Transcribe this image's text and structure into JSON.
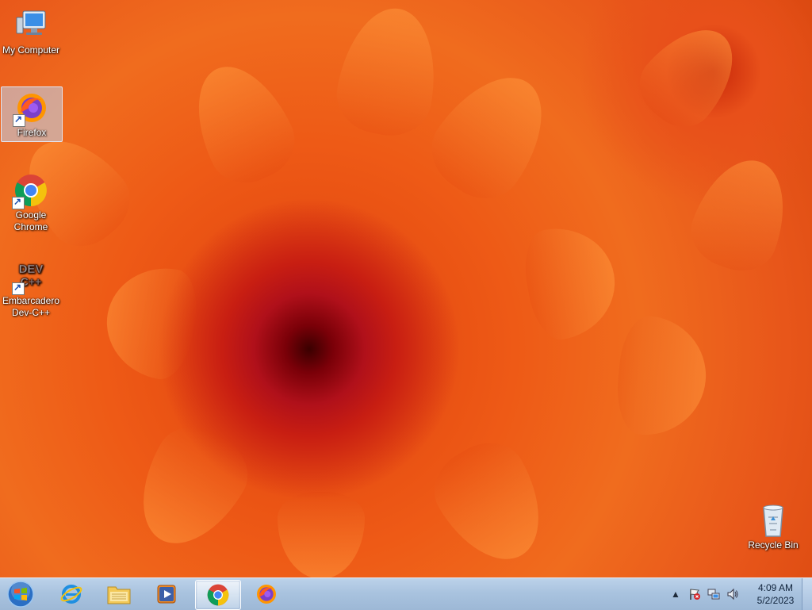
{
  "desktop": {
    "icons": [
      {
        "label": "My Computer",
        "icon": "computer-icon"
      },
      {
        "label": "Firefox",
        "icon": "firefox-icon",
        "selected": true
      },
      {
        "label": "Google Chrome",
        "icon": "chrome-icon"
      },
      {
        "label": "Embarcadero Dev-C++",
        "icon": "devcpp-icon",
        "badge": "DEV C++"
      },
      {
        "label": "Recycle Bin",
        "icon": "recycle-bin-icon"
      }
    ],
    "wallpaper": {
      "accent": "#e8501a",
      "center": "#7a0008"
    }
  },
  "taskbar": {
    "pinned": [
      {
        "name": "start-button",
        "icon": "windows-logo-icon"
      },
      {
        "name": "internet-explorer",
        "icon": "internet-explorer-icon"
      },
      {
        "name": "file-explorer",
        "icon": "folder-icon"
      },
      {
        "name": "media-player",
        "icon": "media-player-icon"
      },
      {
        "name": "google-chrome",
        "icon": "chrome-icon",
        "active": true
      },
      {
        "name": "firefox",
        "icon": "firefox-icon"
      }
    ],
    "tray": {
      "icons": [
        "show-hidden-icons-arrow",
        "action-center-flag-icon",
        "network-icon",
        "volume-icon"
      ]
    },
    "clock": {
      "time": "4:09 AM",
      "date": "5/2/2023"
    }
  }
}
